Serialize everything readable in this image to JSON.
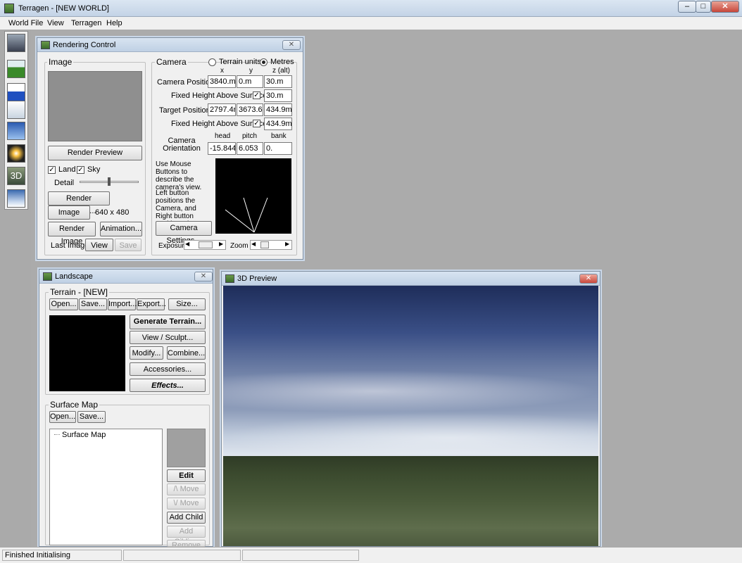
{
  "app": {
    "title": "Terragen  -  [NEW WORLD]"
  },
  "window_controls": {
    "minimize": "–",
    "maximize": "□",
    "close": "✕"
  },
  "menu": [
    "World File",
    "View",
    "Terragen",
    "Help"
  ],
  "toolbar_icons": [
    "render-preview-icon",
    "landscape-icon",
    "water-icon",
    "clouds-icon",
    "sky-icon",
    "sun-icon",
    "3d-preview-icon",
    "atmosphere-icon"
  ],
  "toolbar_3d_label": "3D",
  "rendering_control": {
    "title": "Rendering Control",
    "close": "✕",
    "image_group": "Image",
    "render_preview": "Render Preview",
    "land": "Land",
    "sky": "Sky",
    "detail": "Detail",
    "render_settings": "Render Settings...",
    "image_size_btn": "Image Size...",
    "image_size_value": "640 x 480",
    "render_image": "Render Image",
    "animation": "Animation...",
    "last_image": "Last Image:",
    "view": "View",
    "save": "Save",
    "camera_group": "Camera",
    "terrain_units": "Terrain units",
    "metres": "Metres",
    "col_x": "x",
    "col_y": "y",
    "col_z": "z (alt)",
    "camera_position": "Camera Position",
    "cam_x": "3840.m",
    "cam_y": "0.m",
    "cam_z": "30.m",
    "fixed_height": "Fixed Height Above Surface",
    "cam_fixed": "30.m",
    "target_position": "Target Position",
    "tgt_x": "2797.4m",
    "tgt_y": "3673.6m",
    "tgt_z": "434.9m",
    "tgt_fixed": "434.9m",
    "col_head": "head",
    "col_pitch": "pitch",
    "col_bank": "bank",
    "camera_orientation": "Camera Orientation",
    "head": "-15.844",
    "pitch": "6.053",
    "bank": "0.",
    "help1": "Use Mouse Buttons to describe the camera's view.",
    "help2": "Left button positions the Camera, and Right button positions the Target.",
    "camera_settings": "Camera Settings...",
    "exposure": "Exposure",
    "zoom": "Zoom"
  },
  "landscape": {
    "title": "Landscape",
    "close": "✕",
    "terrain_group": "Terrain - [NEW]",
    "open": "Open...",
    "save": "Save...",
    "import": "Import...",
    "export": "Export...",
    "size": "Size...",
    "generate_terrain": "Generate Terrain...",
    "view_sculpt": "View / Sculpt...",
    "modify": "Modify...",
    "combine": "Combine...",
    "accessories": "Accessories...",
    "effects": "Effects...",
    "surface_group": "Surface Map",
    "sm_open": "Open...",
    "sm_save": "Save...",
    "tree_item": "Surface Map",
    "edit": "Edit",
    "move_up": "/\\ Move",
    "move_down": "\\/ Move",
    "add_child": "Add Child",
    "add_sibling": "Add Sibling",
    "remove": "Remove"
  },
  "preview3d": {
    "title": "3D Preview",
    "close": "✕"
  },
  "status": {
    "text": "Finished Initialising"
  }
}
